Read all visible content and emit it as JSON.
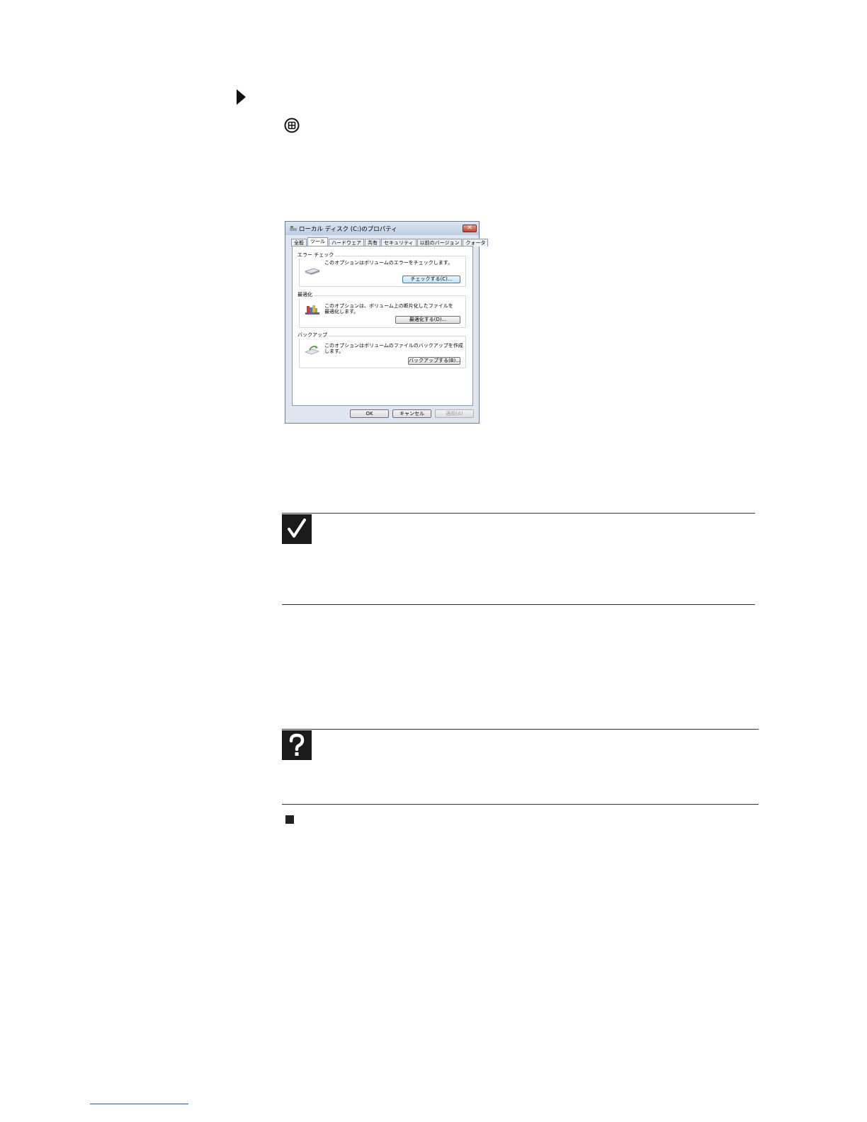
{
  "dialog": {
    "title": "ローカル ディスク (C:)のプロパティ",
    "close_label": "✕",
    "tabs": [
      "全般",
      "ツール",
      "ハードウェア",
      "共有",
      "セキュリティ",
      "以前のバージョン",
      "クォータ"
    ],
    "active_tab": "ツール",
    "groups": [
      {
        "label": "エラー チェック",
        "description": [
          "このオプションはボリュームのエラーをチェックします。"
        ],
        "button": "チェックする(C)..."
      },
      {
        "label": "最適化",
        "description": [
          "このオプションは、ボリューム上の断片化したファイルを",
          "最適化します。"
        ],
        "button": "最適化する(D)..."
      },
      {
        "label": "バックアップ",
        "description": [
          "このオプションはボリュームのファイルのバックアップを作成",
          "します。"
        ],
        "button": "バックアップする(B)..."
      }
    ],
    "buttons": {
      "ok": "OK",
      "cancel": "キャンセル",
      "apply": "適用(A)"
    }
  },
  "icons": {
    "step": "triangle-right-icon",
    "start": "windows-start-icon",
    "important": "checkmark-icon",
    "help": "question-mark-icon",
    "end": "end-square-icon"
  },
  "colors": {
    "dialog_bg": "#dfe6ef",
    "title_bar": "#bccde2",
    "close": "#c6412c",
    "icon_box": "#1a1a1a"
  }
}
